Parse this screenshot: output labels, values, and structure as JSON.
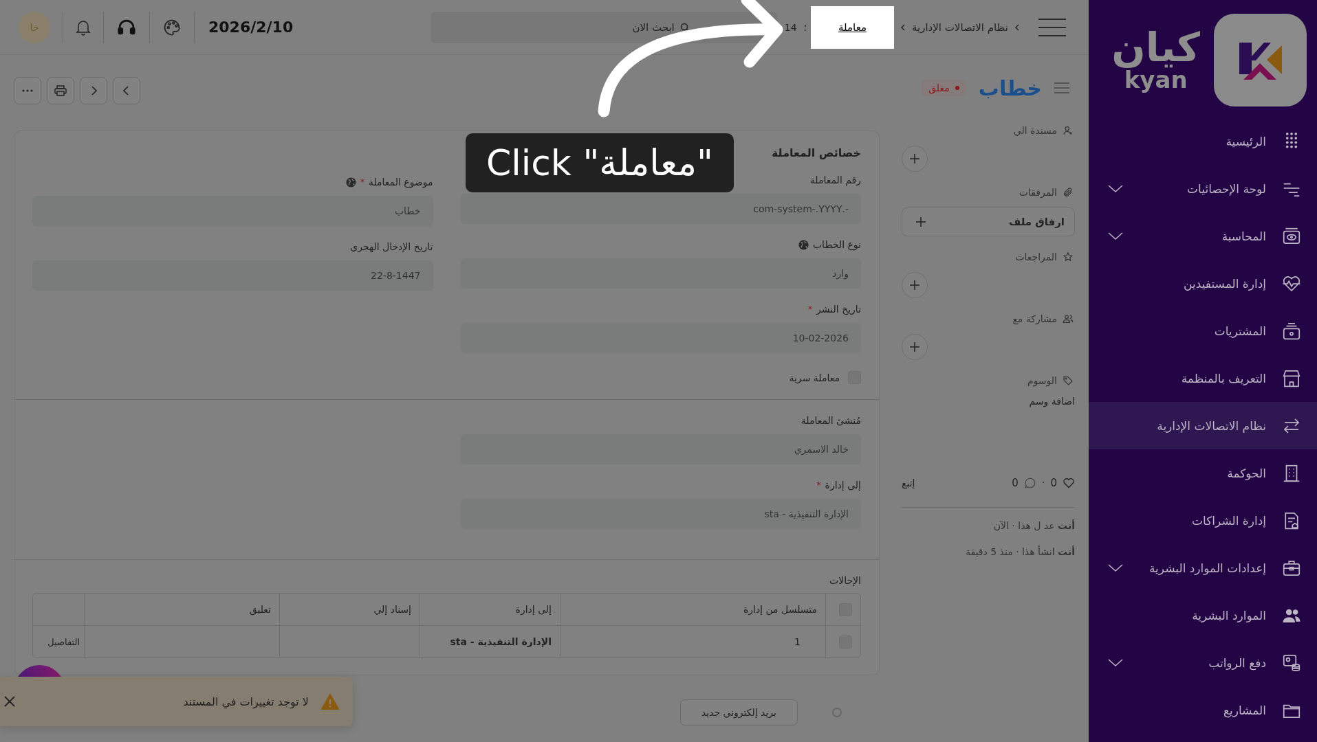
{
  "sidebar": {
    "logo": {
      "arabic": "كيان",
      "latin": "kyan"
    },
    "items": [
      {
        "label": "الرئيسية",
        "selected": false,
        "expandable": false
      },
      {
        "label": "لوحة الإحصائيات",
        "selected": false,
        "expandable": true
      },
      {
        "label": "المحاسبة",
        "selected": false,
        "expandable": true
      },
      {
        "label": "إدارة المستفيدين",
        "selected": false,
        "expandable": false
      },
      {
        "label": "المشتريات",
        "selected": false,
        "expandable": false
      },
      {
        "label": "التعريف بالمنظمة",
        "selected": false,
        "expandable": false
      },
      {
        "label": "نظام الاتصالات الإدارية",
        "selected": true,
        "expandable": false
      },
      {
        "label": "الحوكمة",
        "selected": false,
        "expandable": false
      },
      {
        "label": "إدارة الشراكات",
        "selected": false,
        "expandable": false
      },
      {
        "label": "إعدادات الموارد البشرية",
        "selected": false,
        "expandable": true
      },
      {
        "label": "الموارد البشرية",
        "selected": false,
        "expandable": false
      },
      {
        "label": "دفع الرواتب",
        "selected": false,
        "expandable": true
      },
      {
        "label": "المشاريع",
        "selected": false,
        "expandable": false
      }
    ]
  },
  "topbar": {
    "breadcrumb": [
      {
        "label": "نظام الاتصالات الإدارية",
        "highlighted": false
      },
      {
        "label": "معاملة",
        "highlighted": true
      }
    ],
    "record_separator": "؛",
    "record": "14",
    "search": {
      "placeholder": "ابحث الان"
    },
    "date": "2026/2/10",
    "avatar": "خا"
  },
  "document": {
    "title": "خطاب",
    "status": "مغلق"
  },
  "side_panel": {
    "sections": [
      {
        "kind": "add",
        "label": "مسندة الي"
      },
      {
        "kind": "attach",
        "label": "المرفقات",
        "button": "ارفاق ملف"
      },
      {
        "kind": "add",
        "label": "المراجعات"
      },
      {
        "kind": "add",
        "label": "مشاركة مع"
      },
      {
        "kind": "link",
        "label": "الوسوم",
        "link": "اضافة وسم"
      }
    ],
    "likes": "0",
    "separator": "·",
    "comments": "0",
    "follow": "إتبع",
    "activity": [
      "**أنت** عد ل هذا · الآن",
      "**أنت** انشأ هذا · منذ 5 دقيقة"
    ]
  },
  "form": {
    "title": "خصائص المعاملة",
    "right_fields": [
      {
        "label": "رقم المعاملة",
        "value": "-.com-system-.YYYY",
        "translatable": false
      },
      {
        "label": "نوع الخطاب",
        "value": "وارد",
        "translatable": true
      },
      {
        "label": "تاريخ النشر",
        "required_mark": "*",
        "value": "10-02-2026",
        "translatable": false
      }
    ],
    "confidential": {
      "label": "معاملة سرية",
      "checked": false
    },
    "left_fields": [
      {
        "label": "موضوع المعاملة",
        "required_mark": "*",
        "value": "خطاب",
        "translatable": true
      },
      {
        "label": "تاريخ الإدخال الهجري",
        "value": "22-8-1447",
        "translatable": false
      }
    ],
    "section2_fields": [
      {
        "label": "مُنشئ المعاملة",
        "value": "خالد الاسمري",
        "translatable": false
      },
      {
        "label": "إلى إدارة",
        "required_mark": "*",
        "value": "الإدارة التنفيذية - sta",
        "translatable": false
      }
    ]
  },
  "referrals": {
    "title": "الإحالات",
    "select_all": {
      "checked": false
    },
    "columns": [
      "متسلسل من إدارة",
      "إلى إدارة",
      "إسناد إلي",
      "تعليق"
    ],
    "rows": [
      {
        "checked": false,
        "seq": "1",
        "to_department": "الإدارة التنفيذية - sta",
        "action": "التفاصيل"
      }
    ]
  },
  "toast": {
    "message": "لا توجد تغييرات في المستند"
  },
  "timeline": {
    "button": "بريد إلكتروني جديد"
  },
  "tutorial": {
    "tooltip": "Click \"معاملة\""
  }
}
